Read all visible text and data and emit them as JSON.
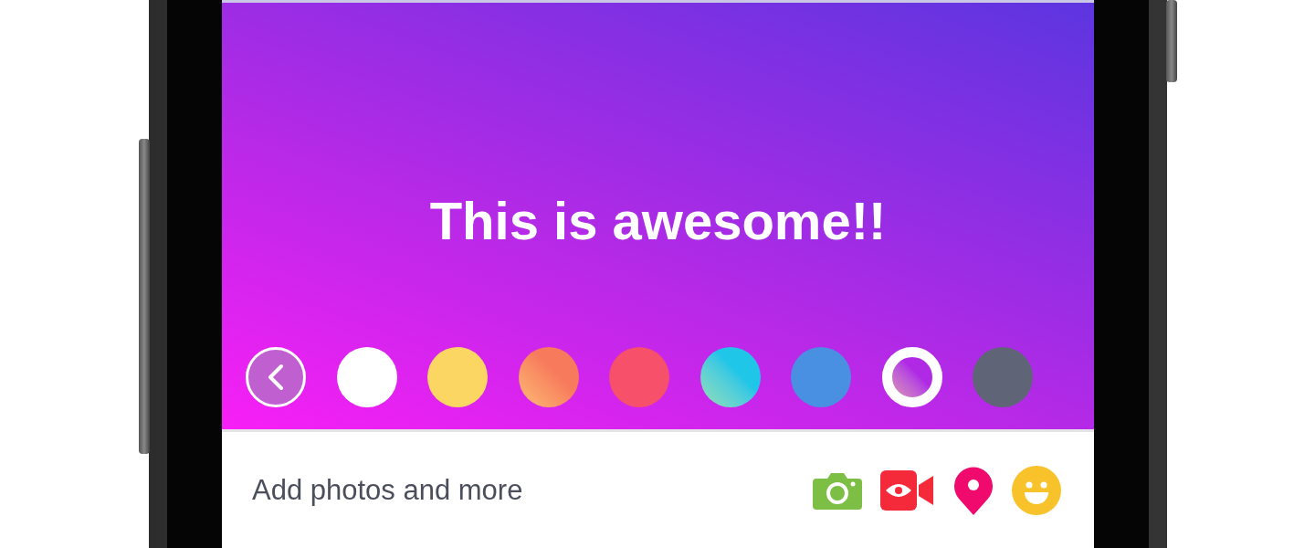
{
  "post": {
    "text": "This is awesome!!"
  },
  "swatches": [
    {
      "color": "#ffffff",
      "selected": false
    },
    {
      "color": "#fcd663",
      "selected": false
    },
    {
      "kind": "gradient",
      "color": "#f77a5c",
      "selected": false
    },
    {
      "color": "#f6506a",
      "selected": false
    },
    {
      "kind": "gradient",
      "color": "#1fc6e8",
      "selected": false
    },
    {
      "color": "#4a90e2",
      "selected": false
    },
    {
      "kind": "gradient",
      "color": "#b02ae6",
      "selected": true
    },
    {
      "color": "#5f6577",
      "selected": false
    }
  ],
  "composer": {
    "label": "Add photos and more"
  }
}
